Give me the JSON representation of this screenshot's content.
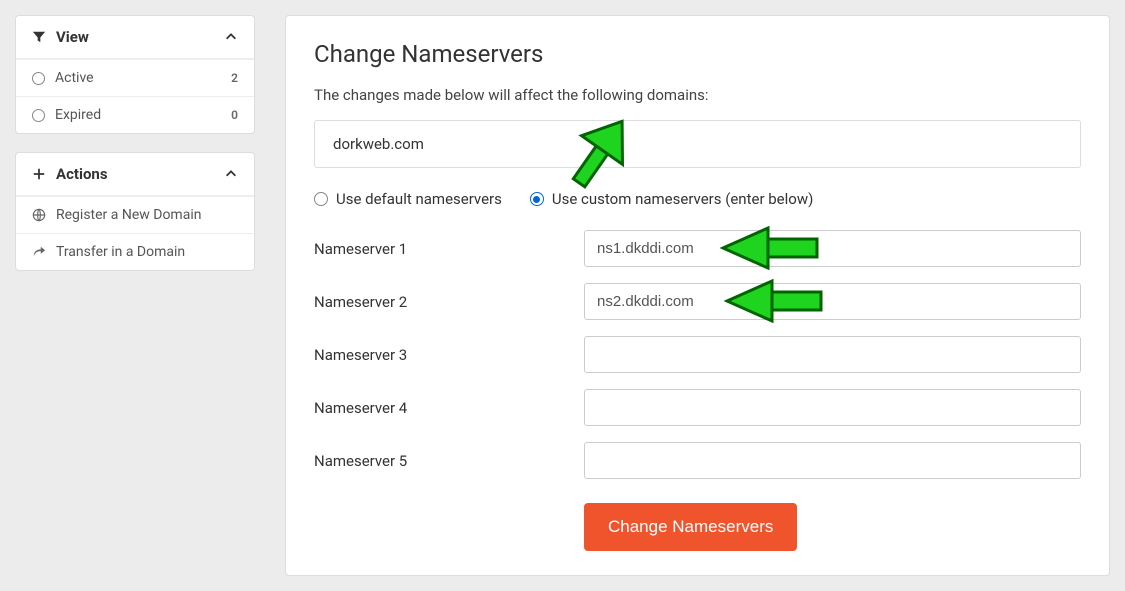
{
  "sidebar": {
    "view": {
      "title": "View",
      "items": [
        {
          "label": "Active",
          "count": "2"
        },
        {
          "label": "Expired",
          "count": "0"
        }
      ]
    },
    "actions": {
      "title": "Actions",
      "items": [
        {
          "label": "Register a New Domain"
        },
        {
          "label": "Transfer in a Domain"
        }
      ]
    }
  },
  "main": {
    "title": "Change Nameservers",
    "description": "The changes made below will affect the following domains:",
    "domain": "dorkweb.com",
    "radio": {
      "default_label": "Use default nameservers",
      "custom_label": "Use custom nameservers (enter below)"
    },
    "fields": [
      {
        "label": "Nameserver 1",
        "value": "ns1.dkddi.com"
      },
      {
        "label": "Nameserver 2",
        "value": "ns2.dkddi.com"
      },
      {
        "label": "Nameserver 3",
        "value": ""
      },
      {
        "label": "Nameserver 4",
        "value": ""
      },
      {
        "label": "Nameserver 5",
        "value": ""
      }
    ],
    "submit_label": "Change Nameservers"
  }
}
